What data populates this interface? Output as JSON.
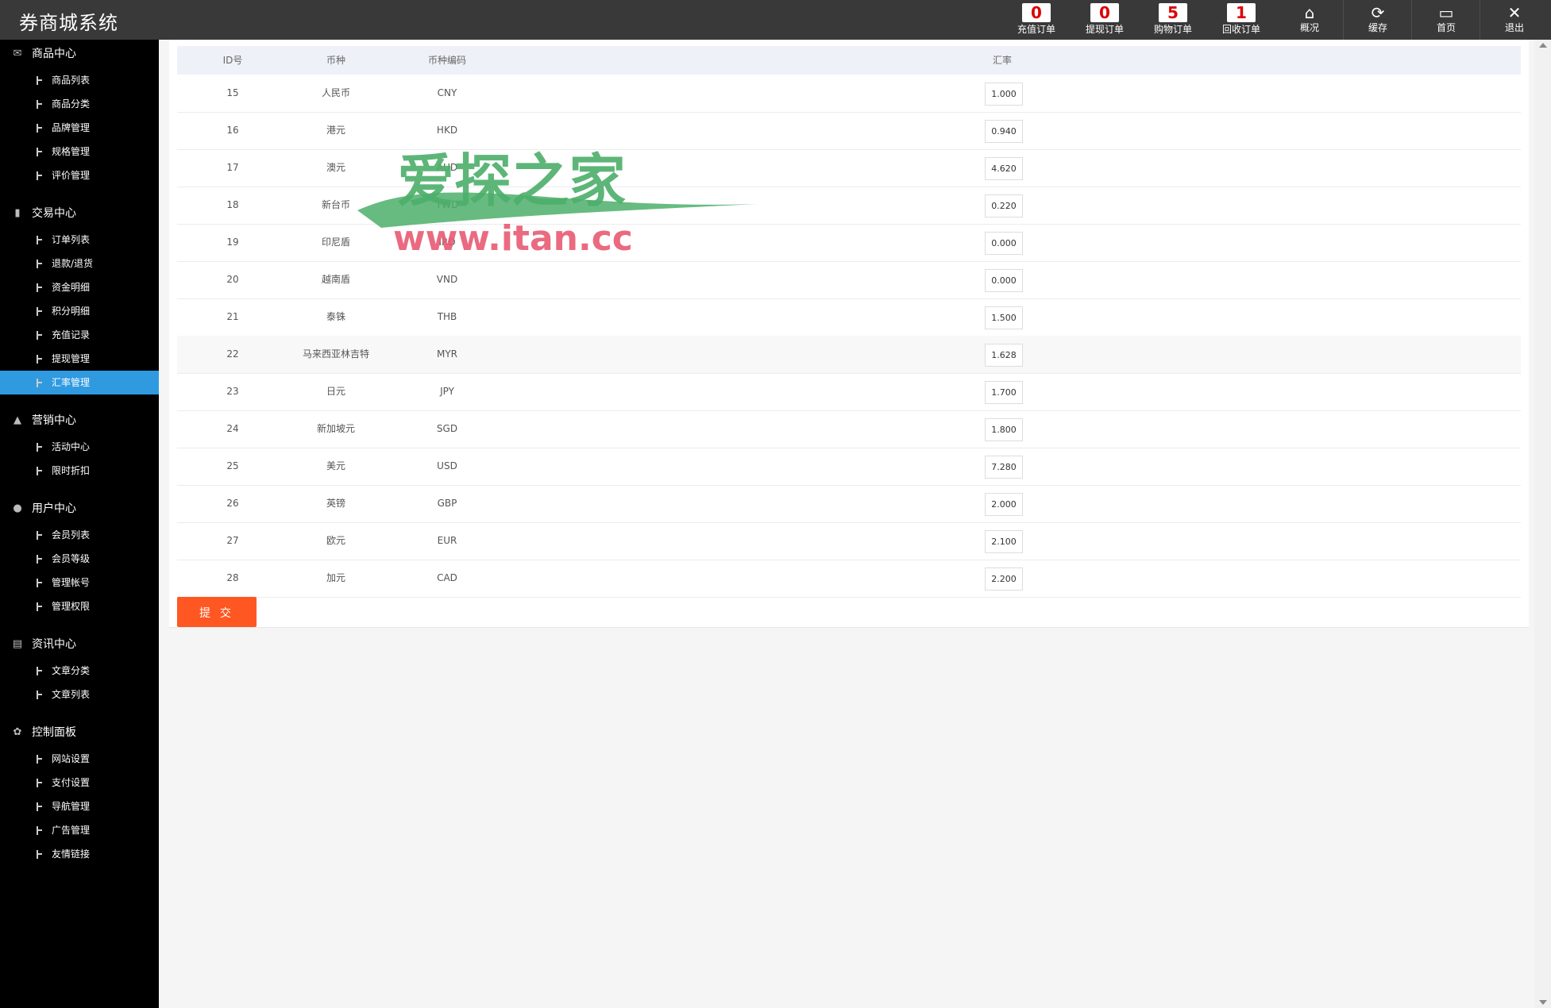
{
  "app": {
    "title": "券商城系统"
  },
  "topbar": {
    "counters": [
      {
        "label": "充值订单",
        "count": "0"
      },
      {
        "label": "提现订单",
        "count": "0"
      },
      {
        "label": "购物订单",
        "count": "5"
      },
      {
        "label": "回收订单",
        "count": "1"
      }
    ],
    "icons": [
      {
        "label": "概况",
        "icon": "home-icon"
      },
      {
        "label": "缓存",
        "icon": "refresh-icon"
      },
      {
        "label": "首页",
        "icon": "monitor-icon"
      },
      {
        "label": "退出",
        "icon": "close-icon"
      }
    ]
  },
  "sidebar": {
    "groups": [
      {
        "title": "商品中心",
        "icon": "mail-icon",
        "items": [
          "商品列表",
          "商品分类",
          "品牌管理",
          "规格管理",
          "评价管理"
        ]
      },
      {
        "title": "交易中心",
        "icon": "bar-chart-icon",
        "items": [
          "订单列表",
          "退款/退货",
          "资金明细",
          "积分明细",
          "充值记录",
          "提现管理",
          "汇率管理"
        ]
      },
      {
        "title": "营销中心",
        "icon": "chart-icon",
        "items": [
          "活动中心",
          "限时折扣"
        ]
      },
      {
        "title": "用户中心",
        "icon": "user-icon",
        "items": [
          "会员列表",
          "会员等级",
          "管理帐号",
          "管理权限"
        ]
      },
      {
        "title": "资讯中心",
        "icon": "document-icon",
        "items": [
          "文章分类",
          "文章列表"
        ]
      },
      {
        "title": "控制面板",
        "icon": "gear-icon",
        "items": [
          "网站设置",
          "支付设置",
          "导航管理",
          "广告管理",
          "友情链接"
        ]
      }
    ],
    "active_item": "汇率管理"
  },
  "table": {
    "headers": {
      "id": "ID号",
      "name": "币种",
      "code": "币种编码",
      "rate": "汇率"
    },
    "rows": [
      {
        "id": "15",
        "name": "人民币",
        "code": "CNY",
        "rate": "1.000"
      },
      {
        "id": "16",
        "name": "港元",
        "code": "HKD",
        "rate": "0.940"
      },
      {
        "id": "17",
        "name": "澳元",
        "code": "AUD",
        "rate": "4.620"
      },
      {
        "id": "18",
        "name": "新台币",
        "code": "TWD",
        "rate": "0.220"
      },
      {
        "id": "19",
        "name": "印尼盾",
        "code": "IRD",
        "rate": "0.000"
      },
      {
        "id": "20",
        "name": "越南盾",
        "code": "VND",
        "rate": "0.000"
      },
      {
        "id": "21",
        "name": "泰铢",
        "code": "THB",
        "rate": "1.500"
      },
      {
        "id": "22",
        "name": "马来西亚林吉特",
        "code": "MYR",
        "rate": "1.628"
      },
      {
        "id": "23",
        "name": "日元",
        "code": "JPY",
        "rate": "1.700"
      },
      {
        "id": "24",
        "name": "新加坡元",
        "code": "SGD",
        "rate": "1.800"
      },
      {
        "id": "25",
        "name": "美元",
        "code": "USD",
        "rate": "7.280"
      },
      {
        "id": "26",
        "name": "英镑",
        "code": "GBP",
        "rate": "2.000"
      },
      {
        "id": "27",
        "name": "欧元",
        "code": "EUR",
        "rate": "2.100"
      },
      {
        "id": "28",
        "name": "加元",
        "code": "CAD",
        "rate": "2.200"
      }
    ],
    "highlighted_row": "22"
  },
  "actions": {
    "submit_label": "提 交"
  },
  "watermark": {
    "title": "爱探之家",
    "url": "www.itan.cc"
  },
  "colors": {
    "active": "#2f9ae0",
    "submit": "#ff5722",
    "topbar": "#393939",
    "sidebar": "#000000"
  }
}
